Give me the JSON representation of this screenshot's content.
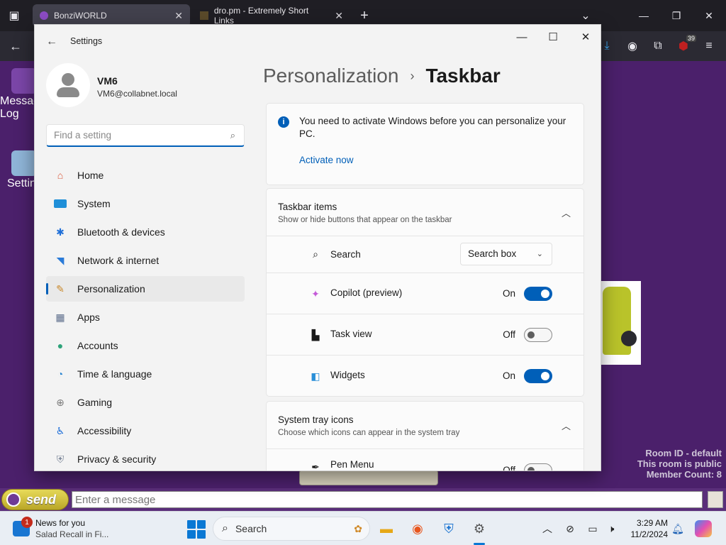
{
  "browser": {
    "tabs": [
      {
        "title": "BonziWORLD",
        "active": true
      },
      {
        "title": "dro.pm - Extremely Short Links",
        "active": false
      }
    ],
    "new_tab_glyph": "+",
    "extension_badge": "39"
  },
  "desktop": {
    "icons": [
      {
        "label": "Message\nLog",
        "icon": "bonzi-monkey-icon"
      },
      {
        "label": "Settin",
        "icon": "computer-settings-icon"
      }
    ],
    "room_info": [
      "Room ID - default",
      "This room is public",
      "Member Count: 8"
    ]
  },
  "chat": {
    "send_label": "send",
    "input_placeholder": "Enter a message"
  },
  "settings": {
    "window_title": "Settings",
    "profile": {
      "name": "VM6",
      "email": "VM6@collabnet.local"
    },
    "search_placeholder": "Find a setting",
    "nav": [
      {
        "label": "Home",
        "icon": "home-icon",
        "selected": false
      },
      {
        "label": "System",
        "icon": "monitor-icon",
        "selected": false
      },
      {
        "label": "Bluetooth & devices",
        "icon": "bluetooth-icon",
        "selected": false
      },
      {
        "label": "Network & internet",
        "icon": "wifi-icon",
        "selected": false
      },
      {
        "label": "Personalization",
        "icon": "brush-icon",
        "selected": true
      },
      {
        "label": "Apps",
        "icon": "apps-icon",
        "selected": false
      },
      {
        "label": "Accounts",
        "icon": "person-icon",
        "selected": false
      },
      {
        "label": "Time & language",
        "icon": "globe-clock-icon",
        "selected": false
      },
      {
        "label": "Gaming",
        "icon": "gamepad-icon",
        "selected": false
      },
      {
        "label": "Accessibility",
        "icon": "accessibility-icon",
        "selected": false
      },
      {
        "label": "Privacy & security",
        "icon": "shield-icon",
        "selected": false
      }
    ],
    "breadcrumb": {
      "parent": "Personalization",
      "separator": "›",
      "current": "Taskbar"
    },
    "activation": {
      "message": "You need to activate Windows before you can personalize your PC.",
      "link": "Activate now"
    },
    "taskbar_items": {
      "title": "Taskbar items",
      "subtitle": "Show or hide buttons that appear on the taskbar",
      "rows": [
        {
          "label": "Search",
          "icon": "search-icon",
          "control": "dropdown",
          "value": "Search box"
        },
        {
          "label": "Copilot (preview)",
          "icon": "copilot-icon",
          "control": "toggle",
          "state": "On"
        },
        {
          "label": "Task view",
          "icon": "task-view-icon",
          "control": "toggle",
          "state": "Off"
        },
        {
          "label": "Widgets",
          "icon": "widgets-icon",
          "control": "toggle",
          "state": "On"
        }
      ]
    },
    "system_tray": {
      "title": "System tray icons",
      "subtitle": "Choose which icons can appear in the system tray",
      "rows": [
        {
          "label": "Pen Menu",
          "icon": "pen-icon",
          "control": "toggle",
          "state": "Off"
        }
      ]
    }
  },
  "taskbar": {
    "news": {
      "title": "News for you",
      "subtitle": "Salad Recall in Fi...",
      "badge": "1"
    },
    "search_label": "Search",
    "clock": {
      "time": "3:29 AM",
      "date": "11/2/2024"
    }
  },
  "colors": {
    "accent": "#005fb8",
    "desktop": "#4b206b",
    "send": "#d6c63a"
  }
}
